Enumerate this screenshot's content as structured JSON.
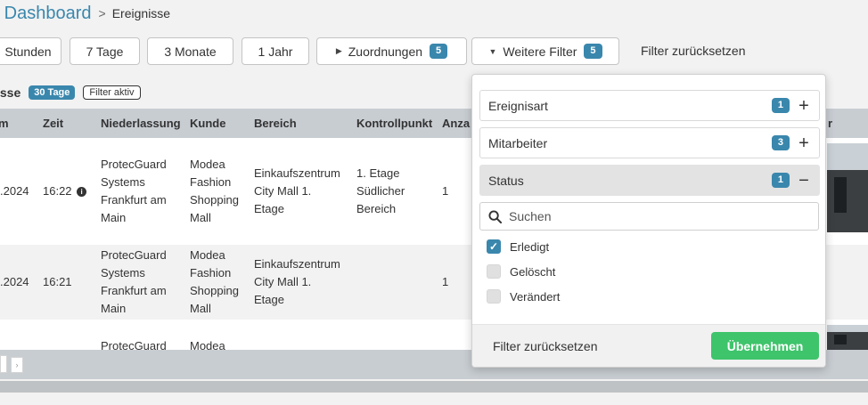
{
  "breadcrumb": {
    "parent": "n Dashboard",
    "separator": ">",
    "current": "Ereignisse"
  },
  "filterbar": {
    "quick_ranges": [
      "Stunden",
      "7 Tage",
      "3 Monate",
      "1 Jahr"
    ],
    "zuordnungen_label": "Zuordnungen",
    "zuordnungen_count": "5",
    "weitere_filter_label": "Weitere Filter",
    "weitere_filter_count": "5",
    "reset_label": "Filter zurücksetzen"
  },
  "section": {
    "title": "isse",
    "range_badge": "30 Tage",
    "filter_badge": "Filter aktiv"
  },
  "table": {
    "headers": [
      "m",
      "Zeit",
      "Niederlassung",
      "Kunde",
      "Bereich",
      "Kontrollpunkt",
      "Anza",
      "r"
    ],
    "rows": [
      {
        "date": ".2024",
        "time": "16:22",
        "has_info": true,
        "niederlassung": [
          "ProtecGuard",
          "Systems",
          "Frankfurt am",
          "Main"
        ],
        "kunde": [
          "Modea",
          "Fashion",
          "Shopping",
          "Mall"
        ],
        "bereich": [
          "Einkaufszentrum",
          "City Mall 1.",
          "Etage"
        ],
        "kontrollpunkt": [
          "1. Etage",
          "Südlicher",
          "Bereich"
        ],
        "anzahl": "1"
      },
      {
        "date": ".2024",
        "time": "16:21",
        "has_info": false,
        "niederlassung": [
          "ProtecGuard",
          "Systems",
          "Frankfurt am",
          "Main"
        ],
        "kunde": [
          "Modea",
          "Fashion",
          "Shopping",
          "Mall"
        ],
        "bereich": [
          "Einkaufszentrum",
          "City Mall 1.",
          "Etage"
        ],
        "kontrollpunkt": [],
        "anzahl": "1"
      },
      {
        "niederlassung": [
          "ProtecGuard"
        ],
        "kunde": [
          "Modea"
        ]
      }
    ]
  },
  "pager": {
    "next_symbol": "›"
  },
  "dropdown": {
    "groups": [
      {
        "label": "Ereignisart",
        "count": "1",
        "toggle": "+"
      },
      {
        "label": "Mitarbeiter",
        "count": "3",
        "toggle": "+"
      },
      {
        "label": "Status",
        "count": "1",
        "toggle": "−"
      }
    ],
    "search_placeholder": "Suchen",
    "options": [
      {
        "label": "Erledigt",
        "checked": true
      },
      {
        "label": "Gelöscht",
        "checked": false
      },
      {
        "label": "Verändert",
        "checked": false
      }
    ],
    "reset_label": "Filter zurücksetzen",
    "apply_label": "Übernehmen"
  },
  "colors": {
    "accent": "#3a87ad",
    "apply_green": "#3ec46b",
    "table_header": "#c8cdd2"
  }
}
